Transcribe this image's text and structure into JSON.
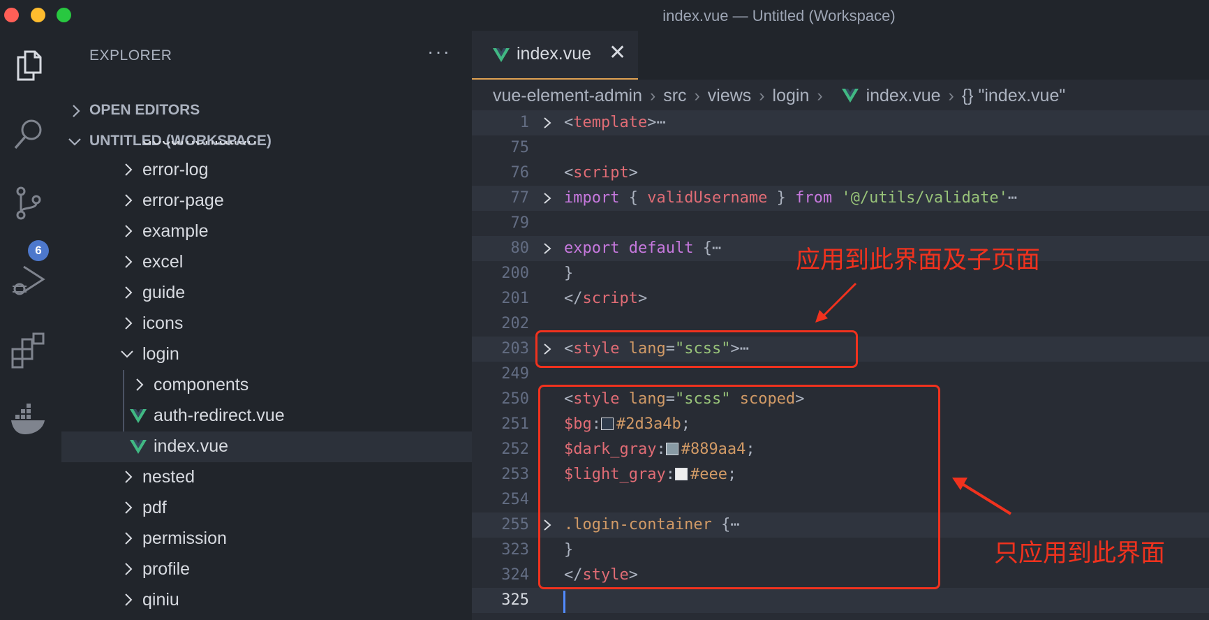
{
  "window": {
    "title": "index.vue — Untitled (Workspace)"
  },
  "traffic_lights": {
    "close_color": "#ff5f57",
    "minimize_color": "#febc2e",
    "zoom_color": "#28c840"
  },
  "activity_bar": {
    "items": [
      {
        "icon": "files-icon"
      },
      {
        "icon": "search-icon"
      },
      {
        "icon": "source-control-icon",
        "badge": "6"
      },
      {
        "icon": "run-debug-icon"
      },
      {
        "icon": "extensions-icon"
      },
      {
        "icon": "docker-icon"
      }
    ]
  },
  "sidebar": {
    "title": "EXPLORER",
    "more": "···",
    "sections": {
      "open_editors": "OPEN EDITORS",
      "workspace": "UNTITLED (WORKSPACE)"
    },
    "tree": [
      {
        "label": "documentation",
        "type": "folder",
        "expanded": false
      },
      {
        "label": "error-log",
        "type": "folder",
        "expanded": false
      },
      {
        "label": "error-page",
        "type": "folder",
        "expanded": false
      },
      {
        "label": "example",
        "type": "folder",
        "expanded": false
      },
      {
        "label": "excel",
        "type": "folder",
        "expanded": false
      },
      {
        "label": "guide",
        "type": "folder",
        "expanded": false
      },
      {
        "label": "icons",
        "type": "folder",
        "expanded": false
      },
      {
        "label": "login",
        "type": "folder",
        "expanded": true
      },
      {
        "label": "components",
        "type": "folder",
        "expanded": false
      },
      {
        "label": "auth-redirect.vue",
        "type": "vue-file"
      },
      {
        "label": "index.vue",
        "type": "vue-file",
        "selected": true
      },
      {
        "label": "nested",
        "type": "folder",
        "expanded": false
      },
      {
        "label": "pdf",
        "type": "folder",
        "expanded": false
      },
      {
        "label": "permission",
        "type": "folder",
        "expanded": false
      },
      {
        "label": "profile",
        "type": "folder",
        "expanded": false
      },
      {
        "label": "qiniu",
        "type": "folder",
        "expanded": false
      }
    ]
  },
  "editor": {
    "tab": {
      "label": "index.vue",
      "close": "✕"
    },
    "breadcrumb": {
      "items": [
        "vue-element-admin",
        "src",
        "views",
        "login",
        "index.vue",
        "{} \"index.vue\""
      ],
      "separator": "›"
    },
    "lines": {
      "l1": {
        "num": "1",
        "a": "<",
        "b": "template",
        "c": ">",
        "d": "⋯"
      },
      "l75": {
        "num": "75"
      },
      "l76": {
        "num": "76",
        "a": "<",
        "b": "script",
        "c": ">"
      },
      "l77": {
        "num": "77",
        "a": "import",
        "b": " { ",
        "c": "validUsername",
        "d": " } ",
        "e": "from",
        "f": " ",
        "g": "'@/utils/validate'",
        "h": "⋯"
      },
      "l79": {
        "num": "79"
      },
      "l80": {
        "num": "80",
        "a": "export",
        "b": " ",
        "c": "default",
        "d": " {",
        "e": "⋯"
      },
      "l200": {
        "num": "200",
        "a": "}"
      },
      "l201": {
        "num": "201",
        "a": "</",
        "b": "script",
        "c": ">"
      },
      "l202": {
        "num": "202"
      },
      "l203": {
        "num": "203",
        "a": "<",
        "b": "style",
        "c": " ",
        "d": "lang",
        "e": "=",
        "f": "\"scss\"",
        "g": ">",
        "h": "⋯"
      },
      "l249": {
        "num": "249"
      },
      "l250": {
        "num": "250",
        "a": "<",
        "b": "style",
        "c": " ",
        "d": "lang",
        "e": "=",
        "f": "\"scss\"",
        "g": " ",
        "h": "scoped",
        "i": ">"
      },
      "l251": {
        "num": "251",
        "a": "$bg",
        "b": ":",
        "c": "#2d3a4b",
        "d": ";",
        "swatch": "#2d3a4b"
      },
      "l252": {
        "num": "252",
        "a": "$dark_gray",
        "b": ":",
        "c": "#889aa4",
        "d": ";",
        "swatch": "#889aa4"
      },
      "l253": {
        "num": "253",
        "a": "$light_gray",
        "b": ":",
        "c": "#eee",
        "d": ";",
        "swatch": "#eeeeee"
      },
      "l254": {
        "num": "254"
      },
      "l255": {
        "num": "255",
        "a": ".login-container",
        "b": " {",
        "c": "⋯"
      },
      "l323": {
        "num": "323",
        "a": "}"
      },
      "l324": {
        "num": "324",
        "a": "</",
        "b": "style",
        "c": ">"
      },
      "l325": {
        "num": "325"
      }
    }
  },
  "annotations": {
    "top_note": "应用到此界面及子页面",
    "bottom_note": "只应用到此界面",
    "color": "#f0321e"
  }
}
